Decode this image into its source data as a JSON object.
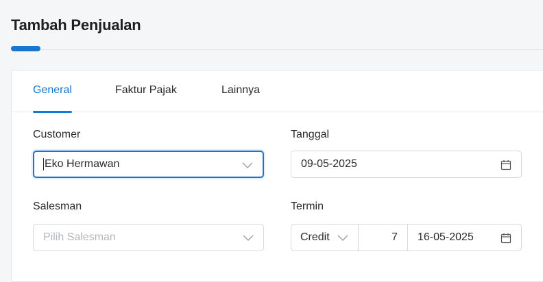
{
  "page": {
    "title": "Tambah Penjualan"
  },
  "tabs": [
    {
      "label": "General",
      "active": true
    },
    {
      "label": "Faktur Pajak",
      "active": false
    },
    {
      "label": "Lainnya",
      "active": false
    }
  ],
  "form": {
    "customer": {
      "label": "Customer",
      "value": "Eko Hermawan"
    },
    "tanggal": {
      "label": "Tanggal",
      "value": "09-05-2025"
    },
    "salesman": {
      "label": "Salesman",
      "placeholder": "Pilih Salesman"
    },
    "termin": {
      "label": "Termin",
      "type": "Credit",
      "days": "7",
      "due_date": "16-05-2025"
    }
  },
  "icons": {
    "dropdown": "chevron-down-icon",
    "calendar": "calendar-icon"
  },
  "colors": {
    "accent": "#1677d2"
  }
}
